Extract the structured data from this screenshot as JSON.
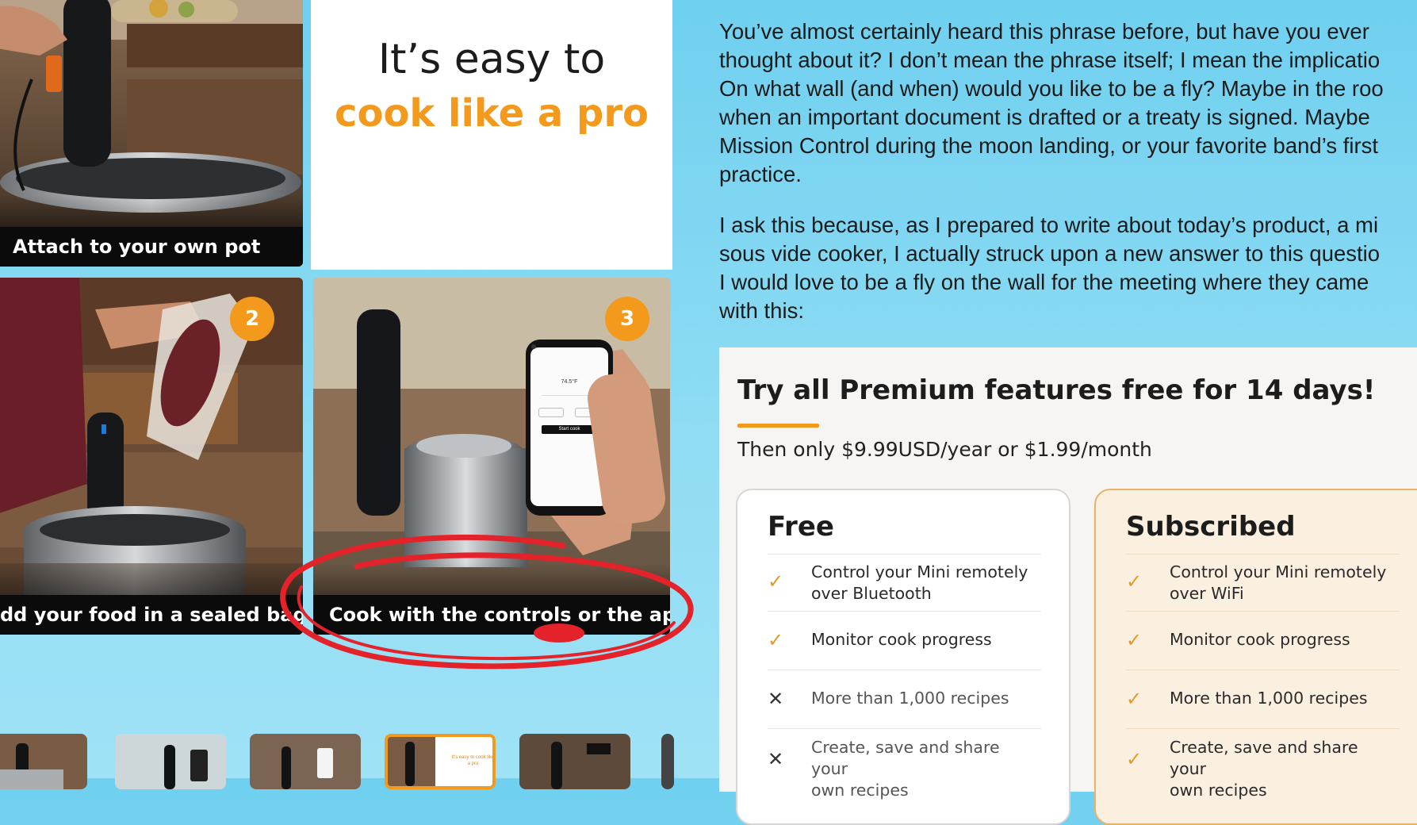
{
  "gallery": {
    "headline_line1": "It’s easy to",
    "headline_line2": "cook like a pro",
    "steps": [
      {
        "caption": "Attach to your own pot"
      },
      {
        "number": "2",
        "caption": "dd your food in a sealed bag"
      },
      {
        "number": "3",
        "caption": "Cook with the controls or the app"
      }
    ],
    "phone": {
      "temp": "74.5°F",
      "button": "Start cook"
    },
    "thumb_text": "It's easy to cook like a pro"
  },
  "article": {
    "paragraph1": [
      "You’ve almost certainly heard this phrase before, but have you ever",
      "thought about it? I don’t mean the phrase itself; I mean the implicatio",
      "On what wall (and when) would you like to be a fly? Maybe in the roo",
      "when an important document is drafted or a treaty is signed. Maybe",
      "Mission Control during the moon landing, or your favorite band’s first",
      "practice."
    ],
    "paragraph2": [
      "I ask this because, as I prepared to write about today’s product, a mi",
      "sous vide cooker, I actually struck upon a new answer to this questio",
      "I would love to be a fly on the wall for the meeting where they came",
      "with this:"
    ]
  },
  "premium": {
    "title": "Try all Premium features free for 14 days!",
    "subtitle": "Then only $9.99USD/year or $1.99/month",
    "accent": "#f39a1c",
    "plans": [
      {
        "name": "Free",
        "features": [
          {
            "status": "check",
            "text": "Control your Mini remotely\nover Bluetooth"
          },
          {
            "status": "check",
            "text": "Monitor cook progress"
          },
          {
            "status": "cross",
            "text": "More than 1,000 recipes"
          },
          {
            "status": "cross",
            "text": "Create, save and share your\nown recipes"
          }
        ]
      },
      {
        "name": "Subscribed",
        "features": [
          {
            "status": "check",
            "text": "Control your Mini remotely\nover WiFi"
          },
          {
            "status": "check",
            "text": "Monitor cook progress"
          },
          {
            "status": "check",
            "text": "More than 1,000 recipes"
          },
          {
            "status": "check",
            "text": "Create, save and share your\nown recipes"
          }
        ]
      }
    ]
  },
  "symbols": {
    "check": "✓",
    "cross": "✕"
  }
}
